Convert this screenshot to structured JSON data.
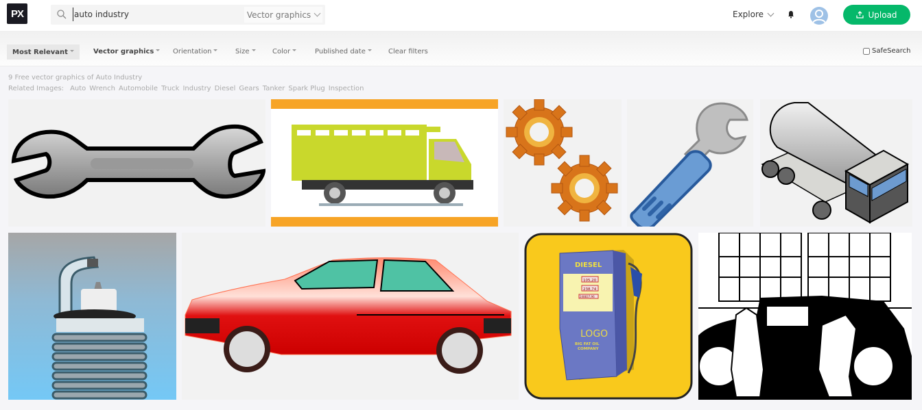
{
  "header": {
    "logo_text": "PX",
    "search": {
      "value": "auto industry",
      "placeholder": ""
    },
    "type_select": "Vector graphics",
    "explore_label": "Explore",
    "upload_label": "Upload",
    "icons": {
      "search": "search-icon",
      "bell": "bell-icon",
      "avatar": "user-avatar-icon",
      "upload": "upload-icon"
    }
  },
  "filters": {
    "items": [
      {
        "label": "Most Relevant",
        "active": true
      },
      {
        "label": "Vector graphics",
        "active": false
      },
      {
        "label": "Orientation",
        "active": false
      },
      {
        "label": "Size",
        "active": false
      },
      {
        "label": "Color",
        "active": false
      },
      {
        "label": "Published date",
        "active": false
      }
    ],
    "clear_label": "Clear filters",
    "safesearch_label": "SafeSearch",
    "safesearch_checked": false
  },
  "results": {
    "count_text": "9 Free vector graphics of Auto Industry",
    "related_label": "Related Images:",
    "related": [
      "Auto",
      "Wrench",
      "Automobile",
      "Truck",
      "Industry",
      "Diesel",
      "Gears",
      "Tanker",
      "Spark Plug",
      "Inspection"
    ]
  },
  "images": [
    {
      "subject": "Wrench"
    },
    {
      "subject": "Truck"
    },
    {
      "subject": "Gears"
    },
    {
      "subject": "Wrench (blue handle)"
    },
    {
      "subject": "Tanker truck"
    },
    {
      "subject": "Spark plug"
    },
    {
      "subject": "Red hatchback car"
    },
    {
      "subject": "Diesel fuel pump",
      "texts": {
        "title": "DIESEL",
        "line1": "105,20",
        "line2": "238,74",
        "line3": "248837,96",
        "logo": "LOGO",
        "company1": "BIG FAT OIL",
        "company2": "COMPANY"
      }
    },
    {
      "subject": "Vintage car inspection"
    }
  ],
  "colors": {
    "accent_green": "#05b86a",
    "truck_orange": "#f7a426",
    "pump_yellow": "#f9c91c"
  }
}
